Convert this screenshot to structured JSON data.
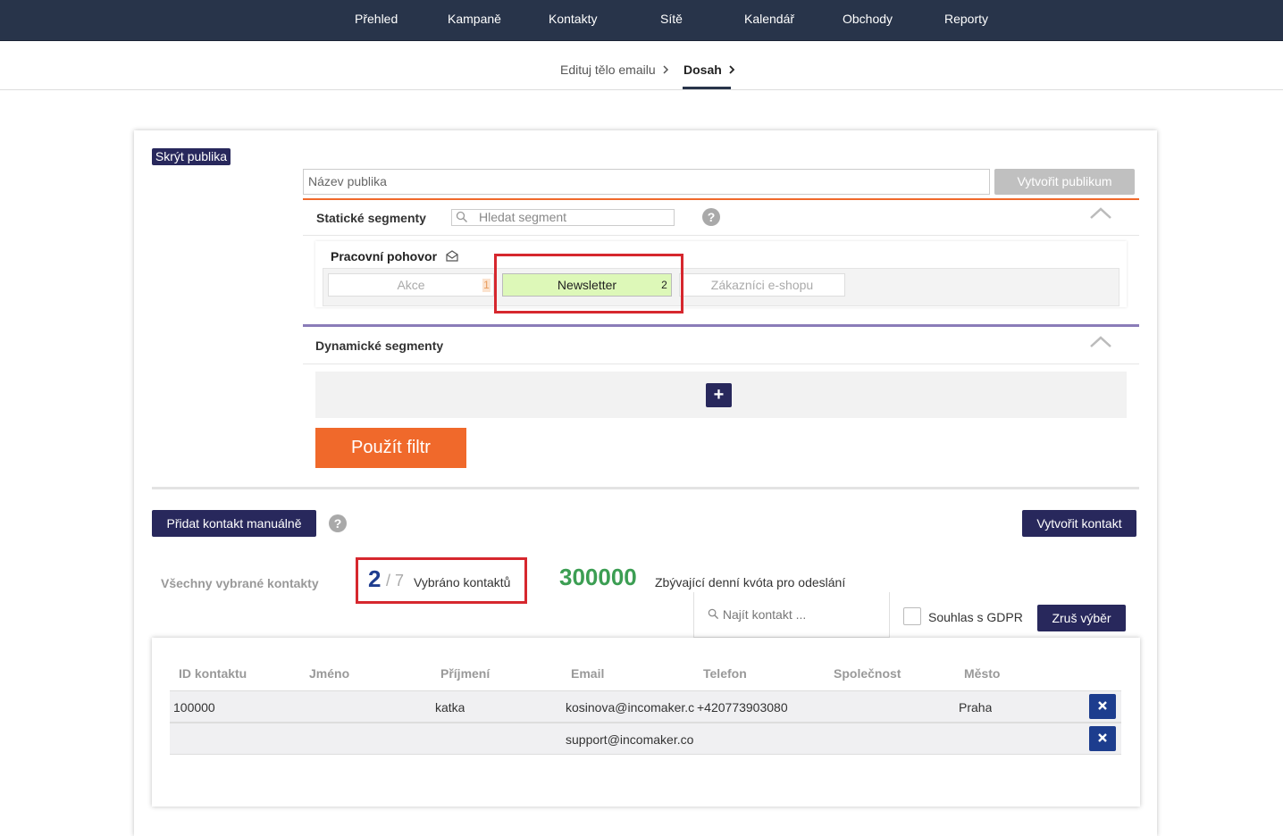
{
  "nav": {
    "items": [
      "Přehled",
      "Kampaně",
      "Kontakty",
      "Sítě",
      "Kalendář",
      "Obchody",
      "Reporty"
    ]
  },
  "breadcrumb": {
    "step1": "Edituj tělo emailu",
    "step2": "Dosah"
  },
  "audience": {
    "hide_button": "Skrýt publika",
    "name_placeholder": "Název publika",
    "create_button": "Vytvořit publikum"
  },
  "static_segments": {
    "title": "Statické segmenty",
    "search_placeholder": "Hledat segment",
    "group_name": "Pracovní pohovor",
    "segments": [
      {
        "label": "Akce",
        "count": "1"
      },
      {
        "label": "Newsletter",
        "count": "2"
      },
      {
        "label": "Zákazníci e-shopu",
        "count": ""
      }
    ]
  },
  "dynamic_segments": {
    "title": "Dynamické segmenty",
    "add_symbol": "+"
  },
  "filter_button": "Použít filtr",
  "contacts": {
    "add_manual": "Přidat kontakt manuálně",
    "create_contact": "Vytvořit kontakt",
    "all_selected_label": "Všechny vybrané kontakty",
    "selected_count": "2",
    "total_count": "/ 7",
    "selected_label": "Vybráno kontaktů",
    "quota_value": "300000",
    "quota_label": "Zbývající denní kvóta pro odeslání",
    "find_placeholder": "Najít kontakt ...",
    "gdpr_label": "Souhlas s GDPR",
    "reset_button": "Zruš výběr"
  },
  "table": {
    "headers": [
      "ID kontaktu",
      "Jméno",
      "Příjmení",
      "Email",
      "Telefon",
      "Společnost",
      "Město"
    ],
    "rows": [
      {
        "id": "100000",
        "first": "",
        "last": "katka",
        "email": "kosinova@incomaker.c",
        "phone": "+420773903080",
        "company": "",
        "city": "Praha"
      },
      {
        "id": "",
        "first": "",
        "last": "",
        "email": "support@incomaker.co",
        "phone": "",
        "company": "",
        "city": ""
      }
    ]
  },
  "colors": {
    "nav_bg": "#28344a",
    "primary_dark": "#28285c",
    "orange": "#f0692b",
    "green": "#3c9e53",
    "highlight_red": "#d6272e"
  }
}
